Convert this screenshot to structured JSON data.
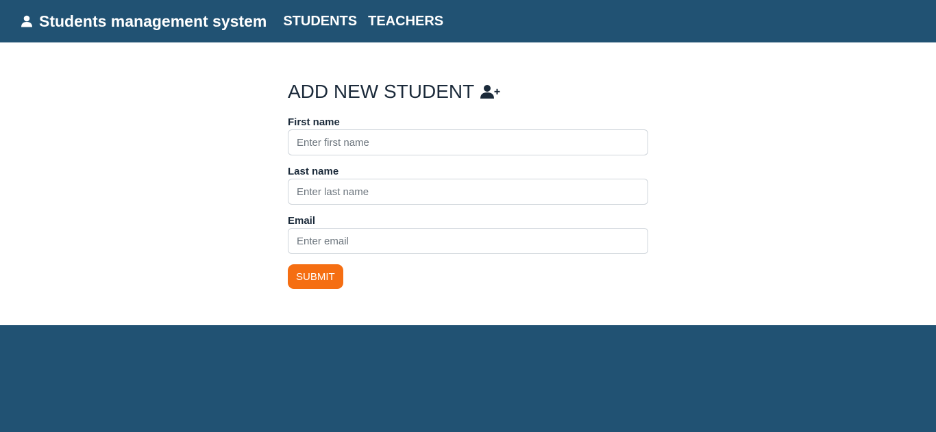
{
  "navbar": {
    "brand_label": "Students management system",
    "brand_icon": "user-icon",
    "links": [
      {
        "label": "STUDENTS"
      },
      {
        "label": "TEACHERS"
      }
    ]
  },
  "form": {
    "title": "ADD NEW STUDENT",
    "title_icon": "user-plus-icon",
    "fields": [
      {
        "label": "First name",
        "placeholder": "Enter first name",
        "value": ""
      },
      {
        "label": "Last name",
        "placeholder": "Enter last name",
        "value": ""
      },
      {
        "label": "Email",
        "placeholder": "Enter email",
        "value": ""
      }
    ],
    "submit_label": "SUBMIT"
  },
  "colors": {
    "navbar_bg": "#215273",
    "footer_bg": "#215273",
    "accent": "#f56e12",
    "text_dark": "#1b2a3a"
  }
}
